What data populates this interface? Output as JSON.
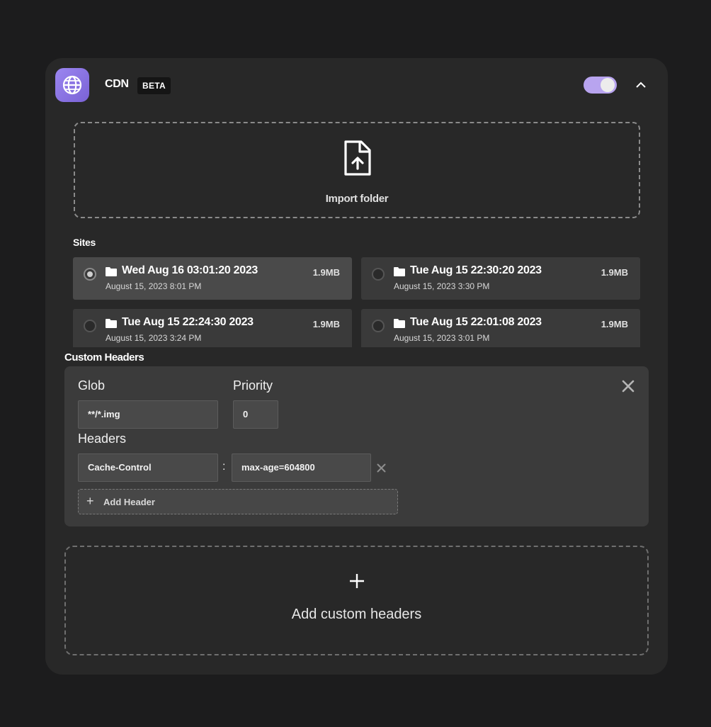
{
  "header": {
    "title": "CDN",
    "badge": "BETA",
    "toggle_on": true,
    "colors": {
      "accent": "#b8a4ef",
      "icon_gradient_start": "#9b86f0",
      "icon_gradient_end": "#7a62d6"
    }
  },
  "import": {
    "label": "Import folder",
    "icon": "file-upload-icon"
  },
  "sites": {
    "label": "Sites",
    "items": [
      {
        "name": "Wed Aug 16 03:01:20 2023",
        "date": "August 15, 2023 8:01 PM",
        "size": "1.9MB",
        "selected": true
      },
      {
        "name": "Tue Aug 15 22:30:20 2023",
        "date": "August 15, 2023 3:30 PM",
        "size": "1.9MB",
        "selected": false
      },
      {
        "name": "Tue Aug 15 22:24:30 2023",
        "date": "August 15, 2023 3:24 PM",
        "size": "1.9MB",
        "selected": false
      },
      {
        "name": "Tue Aug 15 22:01:08 2023",
        "date": "August 15, 2023 3:01 PM",
        "size": "1.9MB",
        "selected": false
      }
    ]
  },
  "custom_headers": {
    "label": "Custom Headers",
    "rule": {
      "glob_label": "Glob",
      "glob_value": "**/*.img",
      "priority_label": "Priority",
      "priority_value": "0",
      "headers_label": "Headers",
      "header_key": "Cache-Control",
      "header_separator": ":",
      "header_value": "max-age=604800",
      "add_header_label": "Add Header"
    },
    "add_label": "Add custom headers"
  }
}
